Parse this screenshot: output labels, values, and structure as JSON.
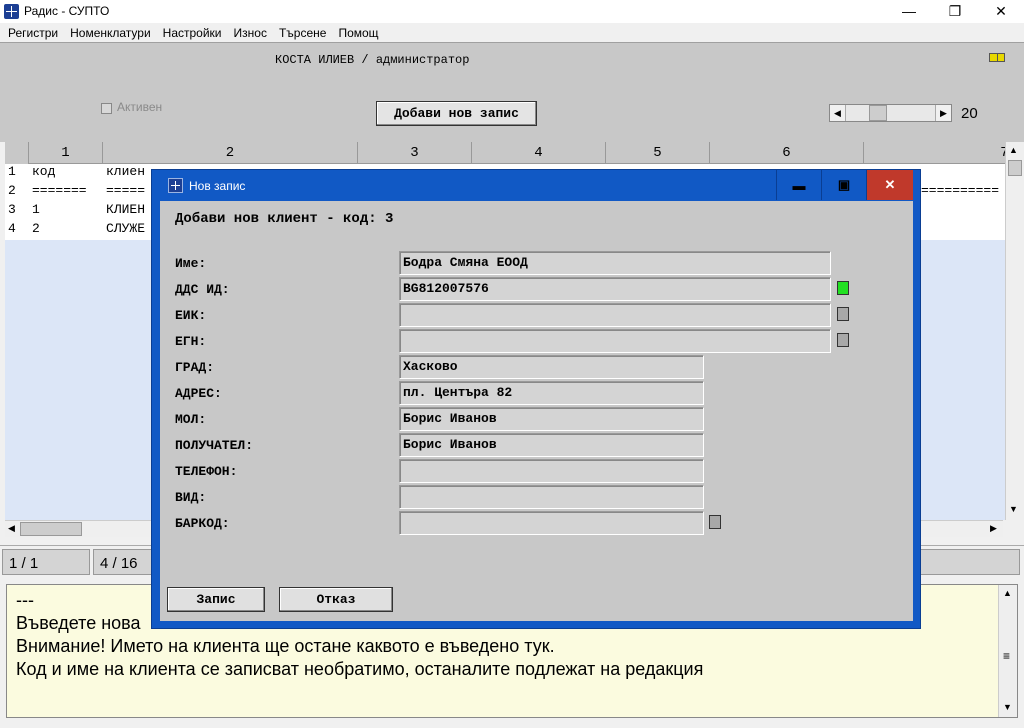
{
  "window": {
    "title": "Радис - СУПТО"
  },
  "menu": [
    "Регистри",
    "Номенклатури",
    "Настройки",
    "Износ",
    "Търсене",
    "Помощ"
  ],
  "header": {
    "user": "КОСТА ИЛИЕВ / администратор",
    "active_label": "Активен",
    "add_button": "Добави нов запис",
    "page_size": "20"
  },
  "grid": {
    "columns": [
      "1",
      "2",
      "3",
      "4",
      "5",
      "6",
      "7"
    ],
    "rows": [
      {
        "num": "1",
        "c1": "код",
        "c2": "клиен"
      },
      {
        "num": "2",
        "c1": "=======",
        "c2": "====="
      },
      {
        "num": "3",
        "c1": "1",
        "c2": "КЛИЕН"
      },
      {
        "num": "4",
        "c1": "2",
        "c2": "СЛУЖЕ"
      }
    ],
    "right_rule": "=========="
  },
  "status": {
    "position": "1 / 1",
    "rows": "4 / 16"
  },
  "messages": [
    "---",
    "Въведете нова",
    "Внимание! Името на клиента ще остане каквото е въведено тук.",
    "Код и име на клиента се записват необратимо, останалите подлежат на редакция"
  ],
  "dialog": {
    "title": "Нов запис",
    "heading": "Добави нов клиент - код: 3",
    "fields": [
      {
        "label": "Име:",
        "value": "Бодра Смяна ЕООД"
      },
      {
        "label": "ДДС ИД:",
        "value": "BG812007576"
      },
      {
        "label": "ЕИК:",
        "value": ""
      },
      {
        "label": "ЕГН:",
        "value": ""
      },
      {
        "label": "ГРАД:",
        "value": "Хасково"
      },
      {
        "label": "АДРЕС:",
        "value": "пл. Центъра 82"
      },
      {
        "label": "МОЛ:",
        "value": "Борис Иванов"
      },
      {
        "label": "ПОЛУЧАТЕЛ:",
        "value": "Борис Иванов"
      },
      {
        "label": "ТЕЛЕФОН:",
        "value": ""
      },
      {
        "label": "ВИД:",
        "value": ""
      },
      {
        "label": "БАРКОД:",
        "value": ""
      }
    ],
    "save_button": "Запис",
    "cancel_button": "Отказ"
  },
  "colors": {
    "dialog_frame": "#1159c5",
    "indicator_ok": "#22e022",
    "indicator_empty": "#a8a8a8",
    "message_bg": "#fbfbdf"
  }
}
